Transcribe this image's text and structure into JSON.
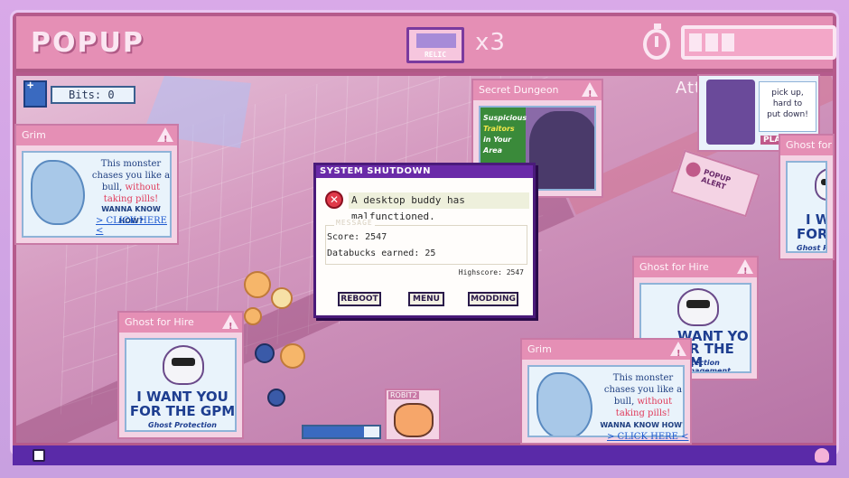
{
  "hud": {
    "title": "POPUP",
    "relic_label": "RELIC",
    "relic_count": "x3",
    "timer_icon": "stopwatch-icon",
    "health_segments_filled": 3,
    "health_segments_total": 10
  },
  "bits": {
    "label": "Bits: 0"
  },
  "attack_text": "Attack th",
  "popups": {
    "grim_left": {
      "title": "Grim",
      "text_1": "This monster chases you like a bull,",
      "text_red": "without taking pills!",
      "question": "WANNA KNOW HOW?",
      "link": "> CLICK HERE <"
    },
    "secret_dungeon": {
      "title": "Secret Dungeon",
      "line1": "Suspicious",
      "line2": "Traitors",
      "line3": "in Your",
      "line4": "Area"
    },
    "pickup_card": {
      "line1": "pick up,",
      "line2": "hard to",
      "line3": "put down!",
      "badge": "PLA"
    },
    "ghost_right_top": {
      "title": "Ghost for",
      "heading_1": "I W",
      "heading_2": "FOR TH",
      "sub": "Ghost Protect"
    },
    "ghost_center_right": {
      "title": "Ghost for Hire",
      "heading_1": "WANT YOU",
      "heading_2": "FOR THE GPM",
      "sub": "Protection Management"
    },
    "ghost_left": {
      "title": "Ghost for Hire",
      "heading_1": "I WANT YOU",
      "heading_2": "FOR THE GPM",
      "sub": "Ghost Protection Management"
    },
    "grim_bottom": {
      "title": "Grim",
      "text_1": "This monster chases you like a bull,",
      "text_red": "without taking pills!",
      "question": "WANNA KNOW HOW?",
      "link": "> CLICK HERE <"
    },
    "popup_alert_sign": "POPUP ALERT"
  },
  "dialog": {
    "title": "SYSTEM SHUTDOWN",
    "error_message": "A desktop buddy has malfunctioned.",
    "message_label": "MESSAGE",
    "score": "Score: 2547",
    "databucks": "Databucks earned: 25",
    "highscore": "Highscore: 2547",
    "buttons": {
      "reboot": "REBOOT",
      "menu": "MENU",
      "modding": "MODDING"
    }
  },
  "character_card": {
    "name": "ROBIT2"
  },
  "colors": {
    "hud_bg": "#e58fb5",
    "dialog_title_bg": "#6a2aa8",
    "bottom_bar": "#5a2aa8",
    "error_red": "#e03a4a"
  }
}
